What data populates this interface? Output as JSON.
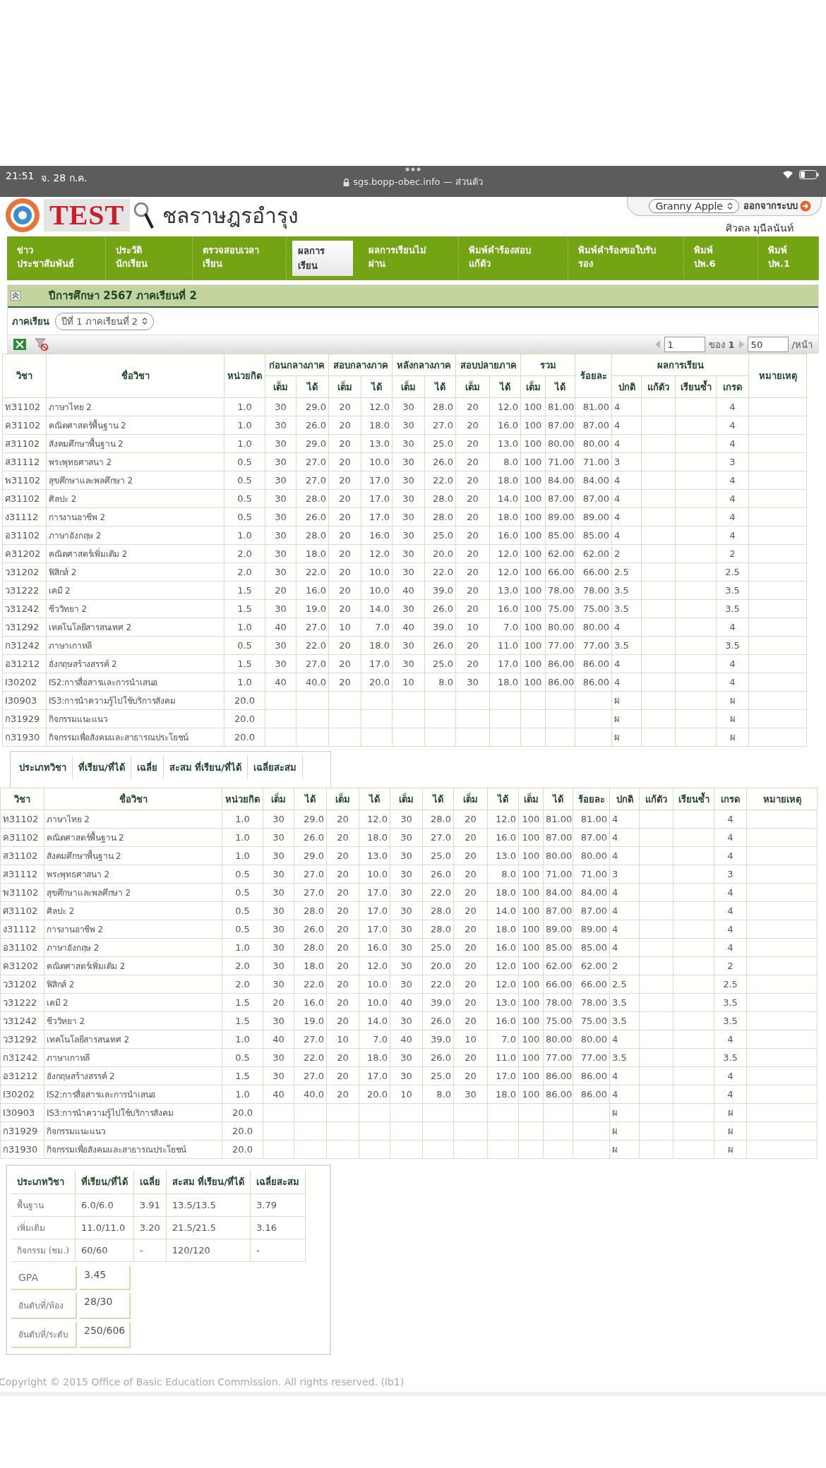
{
  "status_bar": {
    "time": "21:51",
    "date": "จ. 28 ก.ค.",
    "url": "sgs.bopp-obec.info — ส่วนตัว"
  },
  "header": {
    "logo_text": "TEST",
    "school": "ชลราษฎรอำรุง",
    "account_select": "Granny Apple",
    "logout_button": "ออกจากระบบ",
    "user": "ศิวดล มุนีลนันท์"
  },
  "nav": [
    {
      "label": "ข่าว\nประชาสัมพันธ์",
      "selected": false
    },
    {
      "label": "ประวัติ\nนักเรียน",
      "selected": false
    },
    {
      "label": "ตรวจสอบเวลา\nเรียน",
      "selected": false
    },
    {
      "label": "ผลการ\nเรียน",
      "selected": true
    },
    {
      "label": "ผลการเรียนไม่\nผ่าน",
      "selected": false
    },
    {
      "label": "พิมพ์คำร้องสอบ\nแก้ตัว",
      "selected": false
    },
    {
      "label": "พิมพ์คำร้องขอใบรับ\nรอง",
      "selected": false
    },
    {
      "label": "พิมพ์\nปพ.6",
      "selected": false
    },
    {
      "label": "พิมพ์\nปพ.1",
      "selected": false
    }
  ],
  "panel_title": "ปีการศึกษา 2567 ภาคเรียนที่ 2",
  "term_filter": {
    "label": "ภาคเรียน",
    "value": "ปีที่ 1 ภาคเรียนที่ 2"
  },
  "pager": {
    "page": "1",
    "of": "ของ",
    "total": "1",
    "per_page": "50",
    "per_page_label": "/หน้า"
  },
  "table": {
    "columns": {
      "code": "วิชา",
      "name": "ชื่อวิชา",
      "credit": "หน่วยกิต",
      "groups": [
        "ก่อนกลางภาค",
        "สอบกลางภาค",
        "หลังกลางภาค",
        "สอบปลายภาค",
        "รวม"
      ],
      "sub": [
        "เต็ม",
        "ได้",
        "เต็ม",
        "ได้",
        "เต็ม",
        "ได้",
        "เต็ม",
        "ได้",
        "เต็ม",
        "ได้"
      ],
      "percent": "ร้อยละ",
      "result_group": "ผลการเรียน",
      "results": [
        "ปกติ",
        "แก้ตัว",
        "เรียนซ้ำ",
        "เกรด"
      ],
      "note": "หมายเหตุ"
    },
    "rows": [
      {
        "code": "ท31102",
        "name": "ภาษาไทย 2",
        "credit": "1.0",
        "scores": [
          "30",
          "29.0",
          "20",
          "12.0",
          "30",
          "28.0",
          "20",
          "12.0",
          "100",
          "81.00"
        ],
        "percent": "81.00",
        "normal": "4",
        "grade": "4"
      },
      {
        "code": "ค31102",
        "name": "คณิตศาสตร์พื้นฐาน 2",
        "credit": "1.0",
        "scores": [
          "30",
          "26.0",
          "20",
          "18.0",
          "30",
          "27.0",
          "20",
          "16.0",
          "100",
          "87.00"
        ],
        "percent": "87.00",
        "normal": "4",
        "grade": "4"
      },
      {
        "code": "ส31102",
        "name": "สังคมศึกษาพื้นฐาน 2",
        "credit": "1.0",
        "scores": [
          "30",
          "29.0",
          "20",
          "13.0",
          "30",
          "25.0",
          "20",
          "13.0",
          "100",
          "80.00"
        ],
        "percent": "80.00",
        "normal": "4",
        "grade": "4"
      },
      {
        "code": "ส31112",
        "name": "พระพุทธศาสนา 2",
        "credit": "0.5",
        "scores": [
          "30",
          "27.0",
          "20",
          "10.0",
          "30",
          "26.0",
          "20",
          "8.0",
          "100",
          "71.00"
        ],
        "percent": "71.00",
        "normal": "3",
        "grade": "3"
      },
      {
        "code": "พ31102",
        "name": "สุขศึกษาและพลศึกษา 2",
        "credit": "0.5",
        "scores": [
          "30",
          "27.0",
          "20",
          "17.0",
          "30",
          "22.0",
          "20",
          "18.0",
          "100",
          "84.00"
        ],
        "percent": "84.00",
        "normal": "4",
        "grade": "4"
      },
      {
        "code": "ศ31102",
        "name": "ศิลปะ 2",
        "credit": "0.5",
        "scores": [
          "30",
          "28.0",
          "20",
          "17.0",
          "30",
          "28.0",
          "20",
          "14.0",
          "100",
          "87.00"
        ],
        "percent": "87.00",
        "normal": "4",
        "grade": "4"
      },
      {
        "code": "ง31112",
        "name": "การงานอาชีพ 2",
        "credit": "0.5",
        "scores": [
          "30",
          "26.0",
          "20",
          "17.0",
          "30",
          "28.0",
          "20",
          "18.0",
          "100",
          "89.00"
        ],
        "percent": "89.00",
        "normal": "4",
        "grade": "4"
      },
      {
        "code": "อ31102",
        "name": "ภาษาอังกฤษ 2",
        "credit": "1.0",
        "scores": [
          "30",
          "28.0",
          "20",
          "16.0",
          "30",
          "25.0",
          "20",
          "16.0",
          "100",
          "85.00"
        ],
        "percent": "85.00",
        "normal": "4",
        "grade": "4"
      },
      {
        "code": "ค31202",
        "name": "คณิตศาสตร์เพิ่มเติม 2",
        "credit": "2.0",
        "scores": [
          "30",
          "18.0",
          "20",
          "12.0",
          "30",
          "20.0",
          "20",
          "12.0",
          "100",
          "62.00"
        ],
        "percent": "62.00",
        "normal": "2",
        "grade": "2"
      },
      {
        "code": "ว31202",
        "name": "ฟิสิกส์ 2",
        "credit": "2.0",
        "scores": [
          "30",
          "22.0",
          "20",
          "10.0",
          "30",
          "22.0",
          "20",
          "12.0",
          "100",
          "66.00"
        ],
        "percent": "66.00",
        "normal": "2.5",
        "grade": "2.5"
      },
      {
        "code": "ว31222",
        "name": "เคมี 2",
        "credit": "1.5",
        "scores": [
          "20",
          "16.0",
          "20",
          "10.0",
          "40",
          "39.0",
          "20",
          "13.0",
          "100",
          "78.00"
        ],
        "percent": "78.00",
        "normal": "3.5",
        "grade": "3.5"
      },
      {
        "code": "ว31242",
        "name": "ชีววิทยา 2",
        "credit": "1.5",
        "scores": [
          "30",
          "19.0",
          "20",
          "14.0",
          "30",
          "26.0",
          "20",
          "16.0",
          "100",
          "75.00"
        ],
        "percent": "75.00",
        "normal": "3.5",
        "grade": "3.5"
      },
      {
        "code": "ว31292",
        "name": "เทคโนโลยีสารสนเทศ 2",
        "credit": "1.0",
        "scores": [
          "40",
          "27.0",
          "10",
          "7.0",
          "40",
          "39.0",
          "10",
          "7.0",
          "100",
          "80.00"
        ],
        "percent": "80.00",
        "normal": "4",
        "grade": "4"
      },
      {
        "code": "ก31242",
        "name": "ภาษาเกาหลี",
        "credit": "0.5",
        "scores": [
          "30",
          "22.0",
          "20",
          "18.0",
          "30",
          "26.0",
          "20",
          "11.0",
          "100",
          "77.00"
        ],
        "percent": "77.00",
        "normal": "3.5",
        "grade": "3.5"
      },
      {
        "code": "อ31212",
        "name": "อังกฤษสร้างสรรค์ 2",
        "credit": "1.5",
        "scores": [
          "30",
          "27.0",
          "20",
          "17.0",
          "30",
          "25.0",
          "20",
          "17.0",
          "100",
          "86.00"
        ],
        "percent": "86.00",
        "normal": "4",
        "grade": "4"
      },
      {
        "code": "I30202",
        "name": "IS2:การสื่อสารและการนำเสนอ",
        "credit": "1.0",
        "scores": [
          "40",
          "40.0",
          "20",
          "20.0",
          "10",
          "8.0",
          "30",
          "18.0",
          "100",
          "86.00"
        ],
        "percent": "86.00",
        "normal": "4",
        "grade": "4"
      },
      {
        "code": "I30903",
        "name": "IS3:การนำความรู้ไปใช้บริการสังคม",
        "credit": "20.0",
        "normal": "ผ",
        "grade": "ผ"
      },
      {
        "code": "ก31929",
        "name": "กิจกรรมแนะแนว",
        "credit": "20.0",
        "normal": "ผ",
        "grade": "ผ"
      },
      {
        "code": "ก31930",
        "name": "กิจกรรมเพื่อสังคมและสาธารณประโยชน์",
        "credit": "20.0",
        "normal": "ผ",
        "grade": "ผ"
      }
    ]
  },
  "summary_partial": {
    "columns": [
      "ประเภทวิชา",
      "ที่เรียน/ที่ได้",
      "เฉลี่ย",
      "สะสม ที่เรียน/ที่ได้",
      "เฉลี่ยสะสม"
    ]
  },
  "table_2": {
    "columns": {
      "code": "วิชา",
      "name": "ชื่อวิชา",
      "credit": "หน่วยกิต",
      "sub": [
        "เต็ม",
        "ได้",
        "เต็ม",
        "ได้",
        "เต็ม",
        "ได้",
        "เต็ม",
        "ได้",
        "เต็ม",
        "ได้"
      ],
      "percent": "ร้อยละ",
      "results": [
        "ปกติ",
        "แก้ตัว",
        "เรียนซ้ำ",
        "เกรด"
      ],
      "note": "หมายเหตุ"
    },
    "rows": [
      {
        "code": "ท31102",
        "name": "ภาษาไทย 2",
        "credit": "1.0",
        "scores": [
          "30",
          "29.0",
          "20",
          "12.0",
          "30",
          "28.0",
          "20",
          "12.0",
          "100",
          "81.00"
        ],
        "percent": "81.00",
        "normal": "4",
        "grade": "4"
      },
      {
        "code": "ค31102",
        "name": "คณิตศาสตร์พื้นฐาน 2",
        "credit": "1.0",
        "scores": [
          "30",
          "26.0",
          "20",
          "18.0",
          "30",
          "27.0",
          "20",
          "16.0",
          "100",
          "87.00"
        ],
        "percent": "87.00",
        "normal": "4",
        "grade": "4"
      },
      {
        "code": "ส31102",
        "name": "สังคมศึกษาพื้นฐาน 2",
        "credit": "1.0",
        "scores": [
          "30",
          "29.0",
          "20",
          "13.0",
          "30",
          "25.0",
          "20",
          "13.0",
          "100",
          "80.00"
        ],
        "percent": "80.00",
        "normal": "4",
        "grade": "4"
      },
      {
        "code": "ส31112",
        "name": "พระพุทธศาสนา 2",
        "credit": "0.5",
        "scores": [
          "30",
          "27.0",
          "20",
          "10.0",
          "30",
          "26.0",
          "20",
          "8.0",
          "100",
          "71.00"
        ],
        "percent": "71.00",
        "normal": "3",
        "grade": "3"
      },
      {
        "code": "พ31102",
        "name": "สุขศึกษาและพลศึกษา 2",
        "credit": "0.5",
        "scores": [
          "30",
          "27.0",
          "20",
          "17.0",
          "30",
          "22.0",
          "20",
          "18.0",
          "100",
          "84.00"
        ],
        "percent": "84.00",
        "normal": "4",
        "grade": "4"
      },
      {
        "code": "ศ31102",
        "name": "ศิลปะ 2",
        "credit": "0.5",
        "scores": [
          "30",
          "28.0",
          "20",
          "17.0",
          "30",
          "28.0",
          "20",
          "14.0",
          "100",
          "87.00"
        ],
        "percent": "87.00",
        "normal": "4",
        "grade": "4"
      },
      {
        "code": "ง31112",
        "name": "การงานอาชีพ 2",
        "credit": "0.5",
        "scores": [
          "30",
          "26.0",
          "20",
          "17.0",
          "30",
          "28.0",
          "20",
          "18.0",
          "100",
          "89.00"
        ],
        "percent": "89.00",
        "normal": "4",
        "grade": "4"
      },
      {
        "code": "อ31102",
        "name": "ภาษาอังกฤษ 2",
        "credit": "1.0",
        "scores": [
          "30",
          "28.0",
          "20",
          "16.0",
          "30",
          "25.0",
          "20",
          "16.0",
          "100",
          "85.00"
        ],
        "percent": "85.00",
        "normal": "4",
        "grade": "4"
      },
      {
        "code": "ค31202",
        "name": "คณิตศาสตร์เพิ่มเติม 2",
        "credit": "2.0",
        "scores": [
          "30",
          "18.0",
          "20",
          "12.0",
          "30",
          "20.0",
          "20",
          "12.0",
          "100",
          "62.00"
        ],
        "percent": "62.00",
        "normal": "2",
        "grade": "2"
      },
      {
        "code": "ว31202",
        "name": "ฟิสิกส์ 2",
        "credit": "2.0",
        "scores": [
          "30",
          "22.0",
          "20",
          "10.0",
          "30",
          "22.0",
          "20",
          "12.0",
          "100",
          "66.00"
        ],
        "percent": "66.00",
        "normal": "2.5",
        "grade": "2.5"
      },
      {
        "code": "ว31222",
        "name": "เคมี 2",
        "credit": "1.5",
        "scores": [
          "20",
          "16.0",
          "20",
          "10.0",
          "40",
          "39.0",
          "20",
          "13.0",
          "100",
          "78.00"
        ],
        "percent": "78.00",
        "normal": "3.5",
        "grade": "3.5"
      },
      {
        "code": "ว31242",
        "name": "ชีววิทยา 2",
        "credit": "1.5",
        "scores": [
          "30",
          "19.0",
          "20",
          "14.0",
          "30",
          "26.0",
          "20",
          "16.0",
          "100",
          "75.00"
        ],
        "percent": "75.00",
        "normal": "3.5",
        "grade": "3.5"
      },
      {
        "code": "ว31292",
        "name": "เทคโนโลยีสารสนเทศ 2",
        "credit": "1.0",
        "scores": [
          "40",
          "27.0",
          "10",
          "7.0",
          "40",
          "39.0",
          "10",
          "7.0",
          "100",
          "80.00"
        ],
        "percent": "80.00",
        "normal": "4",
        "grade": "4"
      },
      {
        "code": "ก31242",
        "name": "ภาษาเกาหลี",
        "credit": "0.5",
        "scores": [
          "30",
          "22.0",
          "20",
          "18.0",
          "30",
          "26.0",
          "20",
          "11.0",
          "100",
          "77.00"
        ],
        "percent": "77.00",
        "normal": "3.5",
        "grade": "3.5"
      },
      {
        "code": "อ31212",
        "name": "อังกฤษสร้างสรรค์ 2",
        "credit": "1.5",
        "scores": [
          "30",
          "27.0",
          "20",
          "17.0",
          "30",
          "25.0",
          "20",
          "17.0",
          "100",
          "86.00"
        ],
        "percent": "86.00",
        "normal": "4",
        "grade": "4"
      },
      {
        "code": "I30202",
        "name": "IS2:การสื่อสารและการนำเสนอ",
        "credit": "1.0",
        "scores": [
          "40",
          "40.0",
          "20",
          "20.0",
          "10",
          "8.0",
          "30",
          "18.0",
          "100",
          "86.00"
        ],
        "percent": "86.00",
        "normal": "4",
        "grade": "4"
      },
      {
        "code": "I30903",
        "name": "IS3:การนำความรู้ไปใช้บริการสังคม",
        "credit": "20.0",
        "normal": "ผ",
        "grade": "ผ"
      },
      {
        "code": "ก31929",
        "name": "กิจกรรมแนะแนว",
        "credit": "20.0",
        "normal": "ผ",
        "grade": "ผ"
      },
      {
        "code": "ก31930",
        "name": "กิจกรรมเพื่อสังคมและสาธารณประโยชน์",
        "credit": "20.0",
        "normal": "ผ",
        "grade": "ผ"
      }
    ]
  },
  "summary": {
    "columns": [
      "ประเภทวิชา",
      "ที่เรียน/ที่ได้",
      "เฉลี่ย",
      "สะสม ที่เรียน/ที่ได้",
      "เฉลี่ยสะสม"
    ],
    "rows": [
      [
        "พื้นฐาน",
        "6.0/6.0",
        "3.91",
        "13.5/13.5",
        "3.79"
      ],
      [
        "เพิ่มเติม",
        "11.0/11.0",
        "3.20",
        "21.5/21.5",
        "3.16"
      ],
      [
        "กิจกรรม (ชม.)",
        "60/60",
        "-",
        "120/120",
        "-"
      ]
    ],
    "stats": [
      {
        "label": "GPA",
        "value": "3.45"
      },
      {
        "label": "อันดับที่/ห้อง",
        "value": "28/30"
      },
      {
        "label": "อันดับที่/ระดับ",
        "value": "250/606"
      }
    ]
  },
  "footer": "Copyright © 2015 Office of Basic Education Commission. All rights reserved. (lb1)"
}
